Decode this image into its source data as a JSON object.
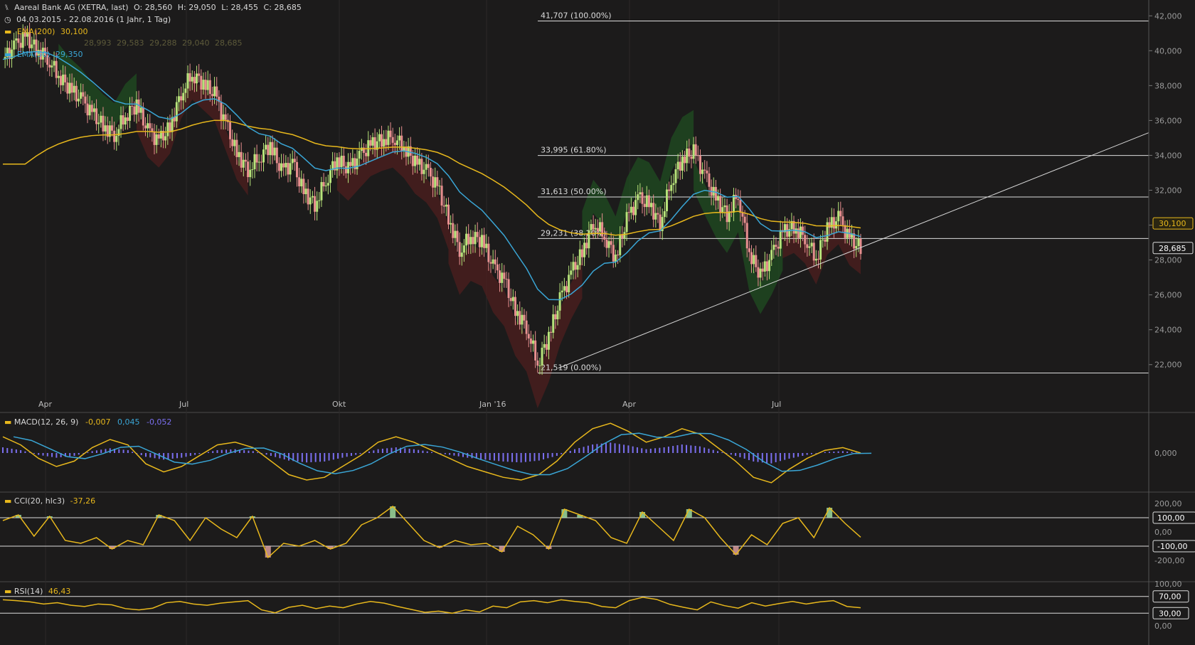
{
  "header": {
    "title": "Aareal Bank AG (XETRA, last)",
    "open": "O: 28,560",
    "high": "H: 29,050",
    "low": "L: 28,455",
    "close": "C: 28,685",
    "range": "04.03.2015 - 22.08.2016 (1 Jahr, 1 Tag)",
    "ema200_label": "EMA(200)",
    "ema200_value": "30,100",
    "ema50_label": "EMA(50)",
    "ema50_value": "29,350",
    "ichimoku_values": [
      "28,993",
      "29,583",
      "29,288",
      "29,040",
      "28,685"
    ]
  },
  "colors": {
    "background": "#1c1b1b",
    "grid": "#3a3a3a",
    "up_candle": "#b7e37a",
    "down_candle": "#e88f8f",
    "ema200": "#e8b81c",
    "ema50": "#3aa6d6",
    "macd_hist": "#7b6ff0",
    "cloud_green": "#1f4d22",
    "cloud_red": "#4d1f1f",
    "cci_fill_up": "#a5e6a5",
    "cci_fill_down": "#e6a5a5"
  },
  "chart_data": [
    {
      "type": "candlestick",
      "name": "price",
      "ylim": [
        21.5,
        42.5
      ],
      "y_ticks": [
        "42,000",
        "40,000",
        "38,000",
        "36,000",
        "34,000",
        "32,000",
        "30,000",
        "28,000",
        "26,000",
        "24,000",
        "22,000"
      ],
      "x_ticks": [
        "Apr",
        "Jul",
        "Okt",
        "Jan '16",
        "Apr",
        "Jul"
      ],
      "fib_levels": [
        {
          "label": "41,707 (100.00%)",
          "value": 41.707
        },
        {
          "label": "33,995 (61.80%)",
          "value": 33.995
        },
        {
          "label": "31,613 (50.00%)",
          "value": 31.613
        },
        {
          "label": "29,231 (38.20%)",
          "value": 29.231
        },
        {
          "label": "21,519 (0.00%)",
          "value": 21.519
        }
      ],
      "price_tags": [
        {
          "label": "30,100",
          "value": 30.1
        },
        {
          "label": "28,685",
          "value": 28.685
        }
      ],
      "trendline": {
        "from": {
          "x": "Feb '16",
          "y": 21.8
        },
        "to": {
          "x": "Sep '16",
          "y": 35.3
        }
      },
      "close_series": [
        39.5,
        40.2,
        40.8,
        40.1,
        39.6,
        38.6,
        37.8,
        37.2,
        36.4,
        35.7,
        35.2,
        36.3,
        36.9,
        35.4,
        34.8,
        35.6,
        37.6,
        38.7,
        38.1,
        37.5,
        35.8,
        34.1,
        33.2,
        33.9,
        34.6,
        33.1,
        33.5,
        31.9,
        31.2,
        32.6,
        33.8,
        33.2,
        33.9,
        34.6,
        34.9,
        35.1,
        34.5,
        33.6,
        33.1,
        32.2,
        30.4,
        28.6,
        29.4,
        29.1,
        27.6,
        26.8,
        25.1,
        24.2,
        22.1,
        23.6,
        25.7,
        27.2,
        28.4,
        30.2,
        29.4,
        28.1,
        30.3,
        31.5,
        31.2,
        30.1,
        32.6,
        33.8,
        34.2,
        32.8,
        31.5,
        30.6,
        31.8,
        28.4,
        27.1,
        28.2,
        29.6,
        29.9,
        29.3,
        28.1,
        29.8,
        30.4,
        29.2,
        28.685
      ]
    },
    {
      "type": "macd",
      "title": "MACD(12, 26, 9)",
      "values": [
        "-0,007",
        "0,045",
        "-0,052"
      ],
      "y_ticks": [
        "0,000"
      ],
      "macd": [
        0.6,
        0.3,
        -0.2,
        -0.5,
        -0.3,
        0.2,
        0.5,
        0.3,
        -0.4,
        -0.7,
        -0.5,
        -0.1,
        0.3,
        0.4,
        0.2,
        -0.3,
        -0.8,
        -1.0,
        -0.9,
        -0.5,
        -0.1,
        0.4,
        0.6,
        0.4,
        0.1,
        -0.2,
        -0.5,
        -0.7,
        -0.9,
        -1.0,
        -0.8,
        -0.3,
        0.4,
        0.9,
        1.1,
        0.8,
        0.4,
        0.6,
        0.9,
        0.7,
        0.2,
        -0.3,
        -0.9,
        -1.1,
        -0.6,
        -0.2,
        0.1,
        0.2,
        0.0
      ]
    },
    {
      "type": "cci",
      "title": "CCI(20, hlc3)",
      "value": "-37,26",
      "y_ticks": [
        "200,00",
        "100,00",
        "0,00",
        "-100,00",
        "-200,00"
      ],
      "levels": [
        100,
        -100
      ],
      "cci": [
        80,
        120,
        -30,
        110,
        -60,
        -80,
        -40,
        -120,
        -60,
        -90,
        120,
        80,
        -60,
        100,
        20,
        -40,
        110,
        -180,
        -80,
        -100,
        -60,
        -120,
        -80,
        50,
        100,
        180,
        60,
        -60,
        -110,
        -60,
        -90,
        -80,
        -140,
        40,
        -20,
        -120,
        160,
        120,
        80,
        -40,
        -80,
        140,
        40,
        -60,
        160,
        100,
        -40,
        -160,
        -20,
        -90,
        60,
        100,
        -40,
        170,
        60,
        -37
      ]
    },
    {
      "type": "rsi",
      "title": "RSI(14)",
      "value": "46,43",
      "y_ticks": [
        "100,00",
        "70,00",
        "30,00",
        "0,00"
      ],
      "levels": [
        70,
        30
      ],
      "rsi": [
        62,
        60,
        57,
        52,
        55,
        49,
        46,
        52,
        50,
        41,
        38,
        42,
        55,
        58,
        52,
        49,
        54,
        57,
        60,
        38,
        31,
        44,
        49,
        41,
        47,
        43,
        52,
        58,
        54,
        46,
        39,
        32,
        35,
        30,
        38,
        33,
        47,
        43,
        57,
        60,
        55,
        62,
        58,
        55,
        46,
        43,
        60,
        68,
        63,
        51,
        44,
        38,
        57,
        48,
        42,
        55,
        47,
        53,
        58,
        52,
        57,
        60,
        46,
        43
      ]
    }
  ]
}
